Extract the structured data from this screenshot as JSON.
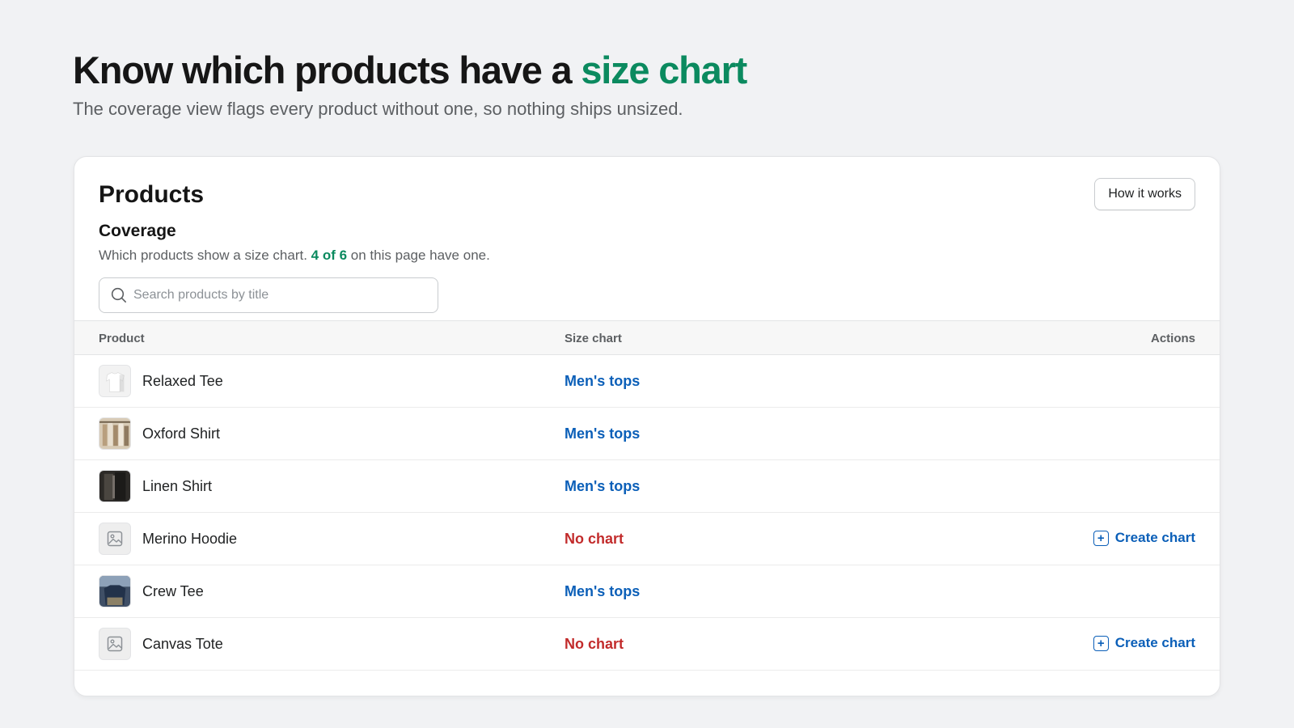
{
  "hero": {
    "title_main": "Know which products have a ",
    "title_accent": "size chart",
    "subtitle": "The coverage view flags every product without one, so nothing ships unsized."
  },
  "card": {
    "title": "Products",
    "how_it_works_label": "How it works",
    "coverage_title": "Coverage",
    "coverage_desc_before": "Which products show a size chart. ",
    "coverage_count": "4 of 6",
    "coverage_desc_after": " on this page have one.",
    "search_placeholder": "Search products by title"
  },
  "table": {
    "headers": {
      "product": "Product",
      "size_chart": "Size chart",
      "actions": "Actions"
    },
    "rows": [
      {
        "name": "Relaxed Tee",
        "size_chart": "Men's tops",
        "has_chart": true,
        "thumb": "photo-white-tee",
        "action": ""
      },
      {
        "name": "Oxford Shirt",
        "size_chart": "Men's tops",
        "has_chart": true,
        "thumb": "photo-shirt-rack",
        "action": ""
      },
      {
        "name": "Linen Shirt",
        "size_chart": "Men's tops",
        "has_chart": true,
        "thumb": "photo-dark-shirt",
        "action": ""
      },
      {
        "name": "Merino Hoodie",
        "size_chart": "No chart",
        "has_chart": false,
        "thumb": "image-placeholder-icon",
        "action": "Create chart"
      },
      {
        "name": "Crew Tee",
        "size_chart": "Men's tops",
        "has_chart": true,
        "thumb": "photo-blue-tee",
        "action": ""
      },
      {
        "name": "Canvas Tote",
        "size_chart": "No chart",
        "has_chart": false,
        "thumb": "image-placeholder-icon",
        "action": "Create chart"
      }
    ]
  },
  "colors": {
    "accent_green": "#0b8a5f",
    "link_blue": "#0b5fb8",
    "alert_red": "#c22b2b"
  }
}
